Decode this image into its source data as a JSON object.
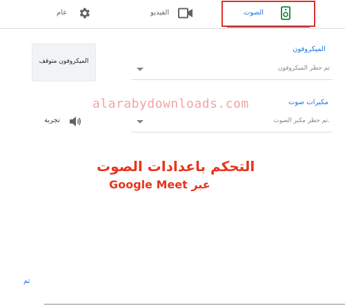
{
  "tabs": {
    "general": {
      "label": "عام",
      "icon": "gear-icon"
    },
    "video": {
      "label": "الفيديو",
      "icon": "video-camera-icon"
    },
    "sound": {
      "label": "الصوت",
      "icon": "speaker-icon",
      "active": true
    }
  },
  "microphone": {
    "label": "الميكروفون",
    "value": "تم حظر الميكروفون",
    "status_button": "الميكروفون متوقف"
  },
  "speakers": {
    "label": "مكبرات صوت",
    "value": "تم حظر مكبر الصوت.",
    "test_button": "تجربة"
  },
  "watermark": "alarabydownloads.com",
  "overlay": {
    "line1": "التحكم باعدادات الصوت",
    "line2": "عبر Google Meet"
  },
  "footer": {
    "done_label": "تم"
  },
  "colors": {
    "accent": "#1a73e8",
    "highlight": "#d93025",
    "overlay_text": "#e8341c"
  }
}
